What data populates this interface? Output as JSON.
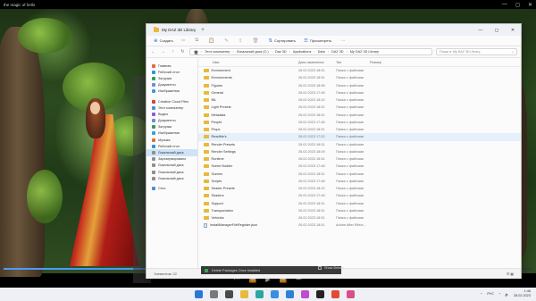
{
  "player": {
    "title": "the magic of hello",
    "controls": [
      "—",
      "◻",
      "✕"
    ],
    "progress": 0.62,
    "toolbar_icons": [
      "prev-icon",
      "rewind-icon",
      "play-icon",
      "forward-icon",
      "next-icon"
    ]
  },
  "explorer": {
    "title": "My DAZ 3D Library",
    "ribbon": [
      {
        "label": "Создать",
        "icon": "new-icon",
        "enabled": true
      },
      {
        "label": "",
        "icon": "cut-icon",
        "enabled": false
      },
      {
        "label": "",
        "icon": "copy-icon",
        "enabled": false
      },
      {
        "label": "",
        "icon": "paste-icon",
        "enabled": false
      },
      {
        "label": "",
        "icon": "rename-icon",
        "enabled": false
      },
      {
        "label": "",
        "icon": "share-icon",
        "enabled": false
      },
      {
        "label": "",
        "icon": "delete-icon",
        "enabled": false
      },
      {
        "label": "Сортировать",
        "icon": "sort-icon",
        "enabled": true
      },
      {
        "label": "Просмотреть",
        "icon": "view-icon",
        "enabled": true
      },
      {
        "label": "···",
        "icon": "more-icon",
        "enabled": true
      }
    ],
    "breadcrumb": [
      "Этот компьютер",
      "Локальный диск (C:)",
      "Daz 3D",
      "Applications",
      "Data",
      "DAZ 3D",
      "My DAZ 3D Library"
    ],
    "search_placeholder": "Поиск в: My DAZ 3D Library",
    "sidebar": [
      {
        "label": "Главная",
        "color": "#e06b3b",
        "selected": false
      },
      {
        "label": "Рабочий стол",
        "color": "#3a8de0",
        "selected": false
      },
      {
        "label": "Загрузки",
        "color": "#2f9e5e",
        "selected": false
      },
      {
        "label": "Документы",
        "color": "#6c8ad6",
        "selected": false
      },
      {
        "label": "Изображения",
        "color": "#3b9dd6",
        "selected": false
      },
      {
        "label": "",
        "color": "",
        "selected": false
      },
      {
        "label": "Creative Cloud Files",
        "color": "#d9442f",
        "selected": false
      },
      {
        "label": "Этот компьютер",
        "color": "#4b8fd9",
        "selected": false
      },
      {
        "label": "Видео",
        "color": "#8a5cd6",
        "selected": false
      },
      {
        "label": "Документы",
        "color": "#6c8ad6",
        "selected": false
      },
      {
        "label": "Загрузки",
        "color": "#2f9e5e",
        "selected": false
      },
      {
        "label": "Изображения",
        "color": "#3b9dd6",
        "selected": false
      },
      {
        "label": "Музыка",
        "color": "#e0703a",
        "selected": false
      },
      {
        "label": "Рабочий стол",
        "color": "#3a8de0",
        "selected": false
      },
      {
        "label": "Локальный диск",
        "color": "#8f8f8f",
        "selected": true
      },
      {
        "label": "Зарезервировано",
        "color": "#8f8f8f",
        "selected": false
      },
      {
        "label": "Локальный диск",
        "color": "#8f8f8f",
        "selected": false
      },
      {
        "label": "Локальный диск",
        "color": "#8f8f8f",
        "selected": false
      },
      {
        "label": "Локальный диск",
        "color": "#8f8f8f",
        "selected": false
      },
      {
        "label": "",
        "color": "",
        "selected": false
      },
      {
        "label": "Сеть",
        "color": "#4b8fd9",
        "selected": false
      }
    ],
    "columns": {
      "name": "Имя",
      "date": "Дата изменения",
      "type": "Тип",
      "size": "Размер"
    },
    "rows": [
      {
        "name": "Environment",
        "date": "26.02.2023 18:51",
        "type": "Папка с файлами",
        "kind": "folder"
      },
      {
        "name": "Environments",
        "date": "26.02.2023 18:51",
        "type": "Папка с файлами",
        "kind": "folder"
      },
      {
        "name": "Figures",
        "date": "26.02.2023 18:58",
        "type": "Папка с файлами",
        "kind": "folder"
      },
      {
        "name": "General",
        "date": "26.02.2023 17:48",
        "type": "Папка с файлами",
        "kind": "folder"
      },
      {
        "name": "IBL",
        "date": "26.02.2023 18:42",
        "type": "Папка с файлами",
        "kind": "folder"
      },
      {
        "name": "Light Presets",
        "date": "26.02.2023 18:51",
        "type": "Папка с файлами",
        "kind": "folder"
      },
      {
        "name": "Metadata",
        "date": "26.02.2023 18:51",
        "type": "Папка с файлами",
        "kind": "folder"
      },
      {
        "name": "People",
        "date": "26.02.2023 17:48",
        "type": "Папка с файлами",
        "kind": "folder"
      },
      {
        "name": "Props",
        "date": "26.02.2023 18:51",
        "type": "Папка с файлами",
        "kind": "folder"
      },
      {
        "name": "ReadMe's",
        "date": "26.02.2023 17:52",
        "type": "Папка с файлами",
        "kind": "folder",
        "hover": true
      },
      {
        "name": "Render Presets",
        "date": "26.02.2023 18:51",
        "type": "Папка с файлами",
        "kind": "folder"
      },
      {
        "name": "Render Settings",
        "date": "26.02.2023 18:09",
        "type": "Папка с файлами",
        "kind": "folder"
      },
      {
        "name": "Runtime",
        "date": "26.02.2023 18:51",
        "type": "Папка с файлами",
        "kind": "folder"
      },
      {
        "name": "Scene Builder",
        "date": "26.02.2023 17:48",
        "type": "Папка с файлами",
        "kind": "folder"
      },
      {
        "name": "Scenes",
        "date": "26.02.2023 18:51",
        "type": "Папка с файлами",
        "kind": "folder"
      },
      {
        "name": "Scripts",
        "date": "26.02.2023 17:48",
        "type": "Папка с файлами",
        "kind": "folder"
      },
      {
        "name": "Shader Presets",
        "date": "26.02.2023 18:42",
        "type": "Папка с файлами",
        "kind": "folder"
      },
      {
        "name": "Shaders",
        "date": "26.02.2023 17:48",
        "type": "Папка с файлами",
        "kind": "folder"
      },
      {
        "name": "Support",
        "date": "26.02.2023 18:51",
        "type": "Папка с файлами",
        "kind": "folder"
      },
      {
        "name": "Transportation",
        "date": "26.02.2023 18:51",
        "type": "Папка с файлами",
        "kind": "folder"
      },
      {
        "name": "Vehicles",
        "date": "26.02.2023 18:51",
        "type": "Папка с файлами",
        "kind": "folder"
      },
      {
        "name": "InstallManagerFileRegister.json",
        "date": "26.02.2023 18:51",
        "type": "Adobe After Effect...",
        "kind": "file"
      }
    ],
    "status_left": "Элементов: 22",
    "status_right": "☰ ▦"
  },
  "installer": {
    "left_label": "Delete Packages Once Installed",
    "right_label": "Show Details"
  },
  "taskbar": {
    "icons": [
      {
        "name": "start-icon",
        "color": "#2a78d6"
      },
      {
        "name": "search-icon",
        "color": "#7a7a7a"
      },
      {
        "name": "taskview-icon",
        "color": "#4a4a4a"
      },
      {
        "name": "explorer-icon",
        "color": "#e8b93a"
      },
      {
        "name": "edge-icon",
        "color": "#2ba6a2"
      },
      {
        "name": "store-icon",
        "color": "#3a8de0"
      },
      {
        "name": "mail-icon",
        "color": "#2f7fd6"
      },
      {
        "name": "photos-icon",
        "color": "#c04bd0"
      },
      {
        "name": "daz-icon",
        "color": "#222222"
      },
      {
        "name": "chrome-icon",
        "color": "#e04b3a"
      },
      {
        "name": "media-icon",
        "color": "#d94f8a"
      }
    ],
    "lang": "РУС",
    "time": "1:46",
    "date": "28.02.2023"
  }
}
